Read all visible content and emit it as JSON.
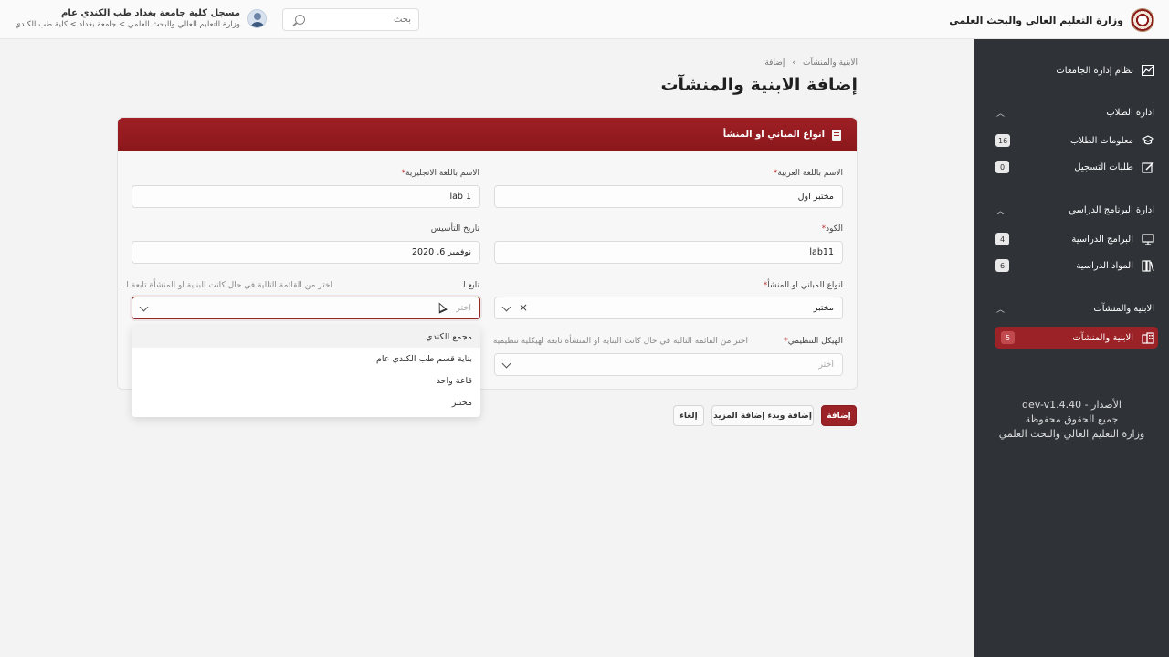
{
  "brand": {
    "title": "وزارة التعليم العالي والبحث العلمي"
  },
  "search": {
    "placeholder": "بحث"
  },
  "user": {
    "name": "مسجل كلية جامعة بغداد طب الكندي عام",
    "path": "وزارة التعليم العالي والبحث العلمي > جامعة بغداد > كلية طب الكندي"
  },
  "sidebar": {
    "system": "نظام إدارة الجامعات",
    "sections": [
      {
        "title": "ادارة الطلاب",
        "items": [
          {
            "label": "معلومات الطلاب",
            "badge": "16",
            "icon": "student-cap-icon"
          },
          {
            "label": "طلبات التسجيل",
            "badge": "0",
            "icon": "edit-form-icon"
          }
        ]
      },
      {
        "title": "ادارة البرنامج الدراسي",
        "items": [
          {
            "label": "البرامج الدراسية",
            "badge": "4",
            "icon": "presentation-icon"
          },
          {
            "label": "المواد الدراسية",
            "badge": "6",
            "icon": "books-icon"
          }
        ]
      },
      {
        "title": "الابنية والمنشآت",
        "items": [
          {
            "label": "الابنية والمنشآت",
            "badge": "5",
            "icon": "building-icon",
            "active": true
          }
        ]
      }
    ],
    "footer": {
      "version": "الأصدار - dev-v1.4.40",
      "rights": "جميع الحقوق محفوظة",
      "org": "وزارة التعليم العالي والبحث العلمي"
    }
  },
  "breadcrumb": {
    "parent": "الابنية والمنشآت",
    "sep": "›",
    "current": "إضافة"
  },
  "page": {
    "title": "إضافة الابنية والمنشآت"
  },
  "form": {
    "section_title": "انواع المباني او المنشأ",
    "name_ar": {
      "label": "الاسم باللغة العربية",
      "value": "مختبر اول"
    },
    "name_en": {
      "label": "الاسم باللغة الانجليزية",
      "value": "lab 1"
    },
    "code": {
      "label": "الكود",
      "value": "lab11"
    },
    "founded": {
      "label": "تاريخ التأسيس",
      "value": "نوفمبر 6, 2020"
    },
    "type": {
      "label": "انواع المباني او المنشأ",
      "value": "مختبر"
    },
    "parent": {
      "label": "تابع لـ",
      "hint": "اختر من القائمة التالية في حال كانت البناية او المنشأة تابعة لـ",
      "placeholder": "اختر",
      "options": [
        "مجمع الكندي",
        "بناية قسم طب الكندي عام",
        "قاعة واحد",
        "مختبر"
      ]
    },
    "org": {
      "label": "الهيكل التنظيمي",
      "hint": "اختر من القائمة التالية في حال كانت البناية او المنشأة تابعة لهيكلية تنظيمية",
      "placeholder": "اختر"
    },
    "required_mark": "*"
  },
  "actions": {
    "add": "إضافة",
    "add_more": "إضافة وبدء إضافة المزيد",
    "cancel": "إلغاء"
  },
  "colors": {
    "accent": "#9b2226",
    "sidebar": "#2f3338"
  }
}
